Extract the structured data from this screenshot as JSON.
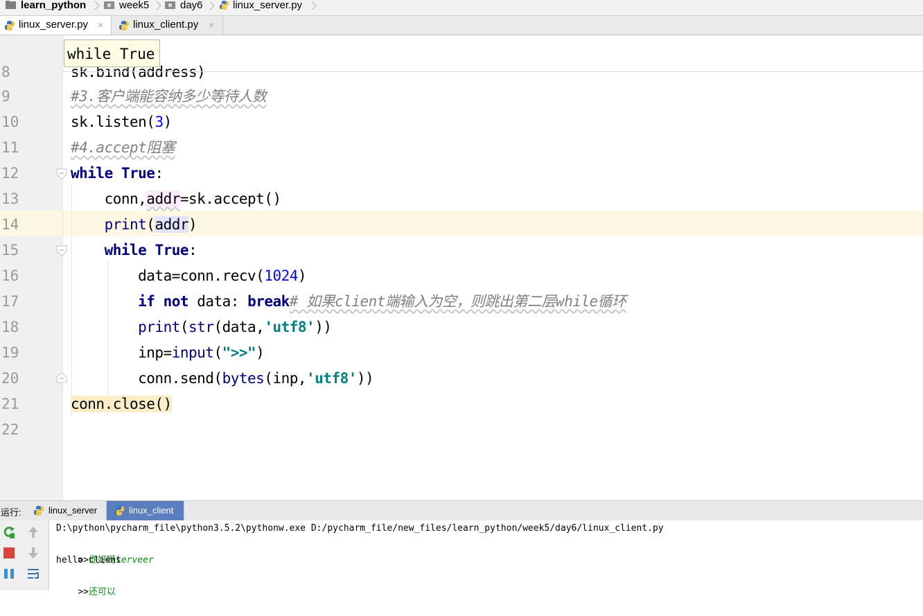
{
  "breadcrumb": {
    "items": [
      {
        "label": "learn_python",
        "icon": "folder-icon"
      },
      {
        "label": "week5",
        "icon": "folder-icon"
      },
      {
        "label": "day6",
        "icon": "folder-icon"
      },
      {
        "label": "linux_server.py",
        "icon": "python-file-icon"
      }
    ]
  },
  "tabs": [
    {
      "label": "linux_server.py",
      "active": true,
      "close": "×"
    },
    {
      "label": "linux_client.py",
      "active": false,
      "close": "×"
    }
  ],
  "editor": {
    "tooltip": "while True",
    "lines": [
      {
        "n": "8",
        "text": "sk.bind(address)"
      },
      {
        "n": "9",
        "text": "#3.客户端能容纳多少等待人数"
      },
      {
        "n": "10",
        "text": "sk.listen(3)"
      },
      {
        "n": "11",
        "text": "#4.accept阻塞"
      },
      {
        "n": "12",
        "text": "while True:"
      },
      {
        "n": "13",
        "text": "    conn,addr=sk.accept()"
      },
      {
        "n": "14",
        "text": "    print(addr)"
      },
      {
        "n": "15",
        "text": "    while True:"
      },
      {
        "n": "16",
        "text": "        data=conn.recv(1024)"
      },
      {
        "n": "17",
        "text": "        if not data: break# 如果client端输入为空，则跳出第二层while循环"
      },
      {
        "n": "18",
        "text": "        print(str(data,'utf8'))"
      },
      {
        "n": "19",
        "text": "        inp=input(\">>\")"
      },
      {
        "n": "20",
        "text": "        conn.send(bytes(inp,'utf8'))"
      },
      {
        "n": "21",
        "text": "conn.close()"
      },
      {
        "n": "22",
        "text": ""
      }
    ],
    "current_line": "14",
    "colors": {
      "keyword": "#000080",
      "number": "#0000ff",
      "string": "#008080",
      "comment": "#808080",
      "current_line_bg": "#fcf8e3"
    }
  },
  "run": {
    "label": "运行:",
    "tabs": [
      {
        "label": "linux_server",
        "active": false
      },
      {
        "label": "linux_client",
        "active": true
      }
    ],
    "tools": [
      "rerun-icon",
      "stop-icon",
      "pause-icon",
      "up-arrow-icon",
      "down-arrow-icon",
      "soft-wrap-icon"
    ],
    "console": {
      "command": "D:\\python\\pycharm_file\\python3.5.2\\pythonw.exe D:/pycharm_file/new_files/learn_python/week5/day6/linux_client.py",
      "line1_prompt": ">>",
      "line1_input_cjk": "你好呀",
      "line1_input_latin": "serveer",
      "line2": "hello client",
      "line3_prompt": ">>",
      "line3_input": "还可以"
    }
  }
}
